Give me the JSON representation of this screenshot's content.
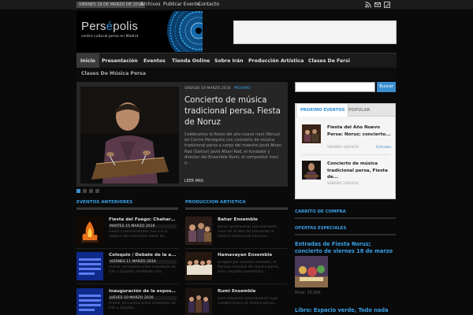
{
  "topbar": {
    "date": "VIERNES 18 DE MARZO DE 2016",
    "links": [
      "Archivos",
      "Publicar Evento",
      "Contacto"
    ]
  },
  "social_icons": [
    "rss-icon",
    "email-icon",
    "twitter-icon"
  ],
  "header": {
    "logo_prefix": "Pers",
    "logo_accent": "é",
    "logo_suffix": "polis",
    "tagline": "centro cultural persa en Madrid"
  },
  "nav": {
    "items": [
      "Inicio",
      "Presentación",
      "Eventos",
      "Tienda Online",
      "Sobre Irán",
      "Producción Artística",
      "Clases De Farsi"
    ],
    "second_row": "Clases De Música Persa",
    "active": "Inicio"
  },
  "slider": {
    "date": "SÁBADO 19 MARZO 2016",
    "category": "PROXIMO",
    "title": "Concierto de música tradicional persa, Fiesta de Noruz",
    "excerpt": "Celebramos la fiesta del año nuevo iraní (Noruz) en Centro Persépolis con concierto de música tradicional  persa a cargo del maestro Javid Afsari Rad (Santur)  Javid Afsari Rad, el fundador y director del Ensemble Rumi, el compositor iraní y...",
    "more": "LEER MAS",
    "slide_count": 4,
    "active_slide": 1
  },
  "eventos_anteriores": {
    "heading": "EVENTOS ANTERIORES",
    "posts": [
      {
        "title": "Fiesta del Fuego: Chahars...",
        "date": "MARTES 15 MARZO 2016",
        "excerpt": "Fiesta Chaharshanbeh Suri En la víspera del miércoles antes de..."
      },
      {
        "title": "Coloquio / Debate de la a...",
        "date": "VIERNES 11 MARZO 2016",
        "excerpt": "Primer encuentro entre creadores de Irán y España, mediante una..."
      },
      {
        "title": "Inauguración de la exposi...",
        "date": "JUEVES 10 MARZO 2016",
        "excerpt": "Primer encuentro entre creadores de Irán y España..."
      }
    ]
  },
  "produccion_artistica": {
    "heading": "PRODUCCION ARTISTICA",
    "posts": [
      {
        "title": "Bahar Ensemble",
        "excerpt": "Bahar (primavera) precisamente nace de la idea de presentar la música tradicional iraní por..."
      },
      {
        "title": "Hamavayan Ensemble",
        "excerpt": "Dirigido por Hossein Alizadeh, el famoso maestro de música persa, este conjunto presentará..."
      },
      {
        "title": "Rumi Ensemble",
        "excerpt": "Esta Orquesta internacional cuyo nombre evoca al místico persa..."
      }
    ]
  },
  "sidebar": {
    "search_button": "Buscar",
    "tabs": [
      "PROXIMO EVENTOS",
      "POPULAR"
    ],
    "items": [
      {
        "title": "Fiesta del Año Nuevo Persa: Noruz; concierto...",
        "date": "VIERNES 18/03/16",
        "category": "Entradas"
      },
      {
        "title": "Concierto de música tradicional persa, Fiesta de...",
        "date": "SÁBADO 19/03/16",
        "category": ""
      }
    ],
    "carrito_heading": "CARRITO DE COMPRA",
    "ofertas_heading": "OFERTAS ESPECIALES",
    "offer1_title": "Entradas de Fiesta Noruz; concierto de viernes 18 de marzo",
    "offer1_price": "Price: 15.00€",
    "offer2_title": "Libro: Espacio verde, Todo nada todo"
  }
}
